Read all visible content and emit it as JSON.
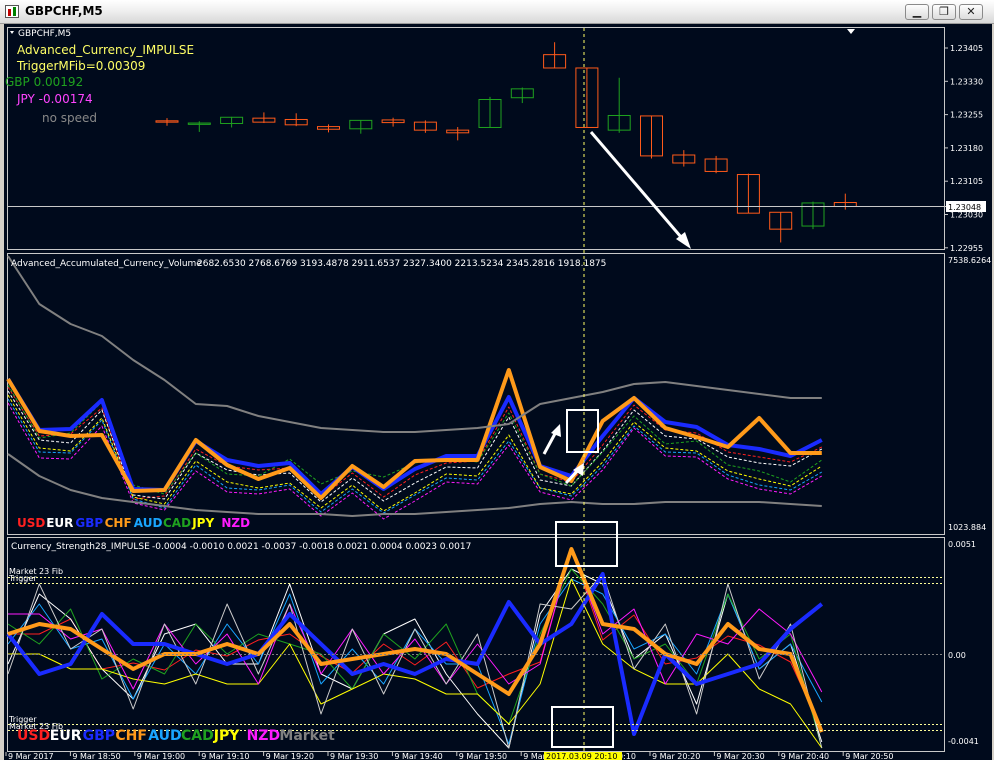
{
  "window": {
    "title": "GBPCHF,M5",
    "minimize_glyph": "▁",
    "restore_glyph": "❐",
    "close_glyph": "✕"
  },
  "colors": {
    "background": "#000a1c",
    "USD": "#ff2020",
    "EUR": "#ffffff",
    "GBP": "#1a2bff",
    "CHF": "#ff9a1a",
    "AUD": "#19a5ff",
    "CAD": "#1fa21f",
    "JPY": "#ffff00",
    "NZD": "#ff1aff",
    "Market": "#808080"
  },
  "price_panel": {
    "symbol_label": "GBPCHF,M5",
    "indicator_name": "Advanced_Currency_IMPULSE",
    "trigger_text": "TriggerMFib=0.00309",
    "gbp_text": "GBP 0.00192",
    "jpy_text": "JPY -0.00174",
    "speed_text": "no speed",
    "price_levels": [
      "1.23405",
      "1.23330",
      "1.23255",
      "1.23180",
      "1.23105",
      "1.23030",
      "1.22955"
    ],
    "bid_price": "1.23048",
    "candles": [
      {
        "o": 1.23241,
        "h": 1.23247,
        "l": 1.2323,
        "c": 1.23238
      },
      {
        "o": 1.23233,
        "h": 1.2324,
        "l": 1.23216,
        "c": 1.23236
      },
      {
        "o": 1.23235,
        "h": 1.2325,
        "l": 1.23226,
        "c": 1.23249
      },
      {
        "o": 1.23247,
        "h": 1.2326,
        "l": 1.23236,
        "c": 1.23238
      },
      {
        "o": 1.23244,
        "h": 1.23258,
        "l": 1.23229,
        "c": 1.23232
      },
      {
        "o": 1.23228,
        "h": 1.23233,
        "l": 1.23215,
        "c": 1.23222
      },
      {
        "o": 1.23223,
        "h": 1.23242,
        "l": 1.23212,
        "c": 1.23242
      },
      {
        "o": 1.23243,
        "h": 1.23248,
        "l": 1.23228,
        "c": 1.23237
      },
      {
        "o": 1.23238,
        "h": 1.23242,
        "l": 1.23214,
        "c": 1.2322
      },
      {
        "o": 1.2322,
        "h": 1.23227,
        "l": 1.23197,
        "c": 1.23214
      },
      {
        "o": 1.23226,
        "h": 1.23295,
        "l": 1.23226,
        "c": 1.23289
      },
      {
        "o": 1.23293,
        "h": 1.23316,
        "l": 1.23281,
        "c": 1.23313
      },
      {
        "o": 1.2339,
        "h": 1.23418,
        "l": 1.2336,
        "c": 1.2336
      },
      {
        "o": 1.2336,
        "h": 1.2336,
        "l": 1.23226,
        "c": 1.23226
      },
      {
        "o": 1.2322,
        "h": 1.23338,
        "l": 1.23214,
        "c": 1.23253
      },
      {
        "o": 1.23252,
        "h": 1.23252,
        "l": 1.23156,
        "c": 1.23162
      },
      {
        "o": 1.23164,
        "h": 1.23175,
        "l": 1.23138,
        "c": 1.23146
      },
      {
        "o": 1.23155,
        "h": 1.23162,
        "l": 1.23123,
        "c": 1.23127
      },
      {
        "o": 1.2312,
        "h": 1.23122,
        "l": 1.23033,
        "c": 1.23033
      },
      {
        "o": 1.23035,
        "h": 1.23035,
        "l": 1.22967,
        "c": 1.22997
      },
      {
        "o": 1.23004,
        "h": 1.23059,
        "l": 1.22997,
        "c": 1.23056
      },
      {
        "o": 1.23057,
        "h": 1.23077,
        "l": 1.23041,
        "c": 1.23048
      }
    ]
  },
  "acv_panel": {
    "title": "Advanced_Accumulated_Currency_Volume",
    "values_text": "2682.6530 2768.6769 3193.4878 2911.6537 2327.3400 2213.5234 2345.2816 1918.1875",
    "scale_max": "7538.6264",
    "scale_min": "1023.884",
    "legend": [
      "USD",
      "EUR",
      "GBP",
      "CHF",
      "AUD",
      "CAD",
      "JPY",
      "NZD"
    ]
  },
  "strength_panel": {
    "title": "Currency_Strength28_IMPULSE",
    "values_text": "-0.0004 -0.0010 0.0021 -0.0037 -0.0018 0.0021 0.0004 0.0023 0.0017",
    "scale_max": "0.0051",
    "scale_zero": "0.00",
    "scale_min": "-0.0041",
    "upper_fib_label": "Market 23 Fib",
    "upper_trigger_label": "Trigger",
    "lower_trigger_label": "Trigger",
    "lower_fib_label": "Market 23 Fib",
    "legend": [
      "USD",
      "EUR",
      "GBP",
      "CHF",
      "AUD",
      "CAD",
      "JPY",
      "NZD",
      "Market"
    ]
  },
  "time_axis": {
    "labels": [
      "9 Mar 2017",
      "9 Mar 18:50",
      "9 Mar 19:00",
      "9 Mar 19:10",
      "9 Mar 19:20",
      "9 Mar 19:30",
      "9 Mar 19:40",
      "9 Mar 19:50",
      "9 Mar 20:00",
      "9 Mar 20:10",
      "9 Mar 20:20",
      "9 Mar 20:30",
      "9 Mar 20:40",
      "9 Mar 20:50"
    ],
    "crosshair_label": "2017.03.09 20:10"
  }
}
